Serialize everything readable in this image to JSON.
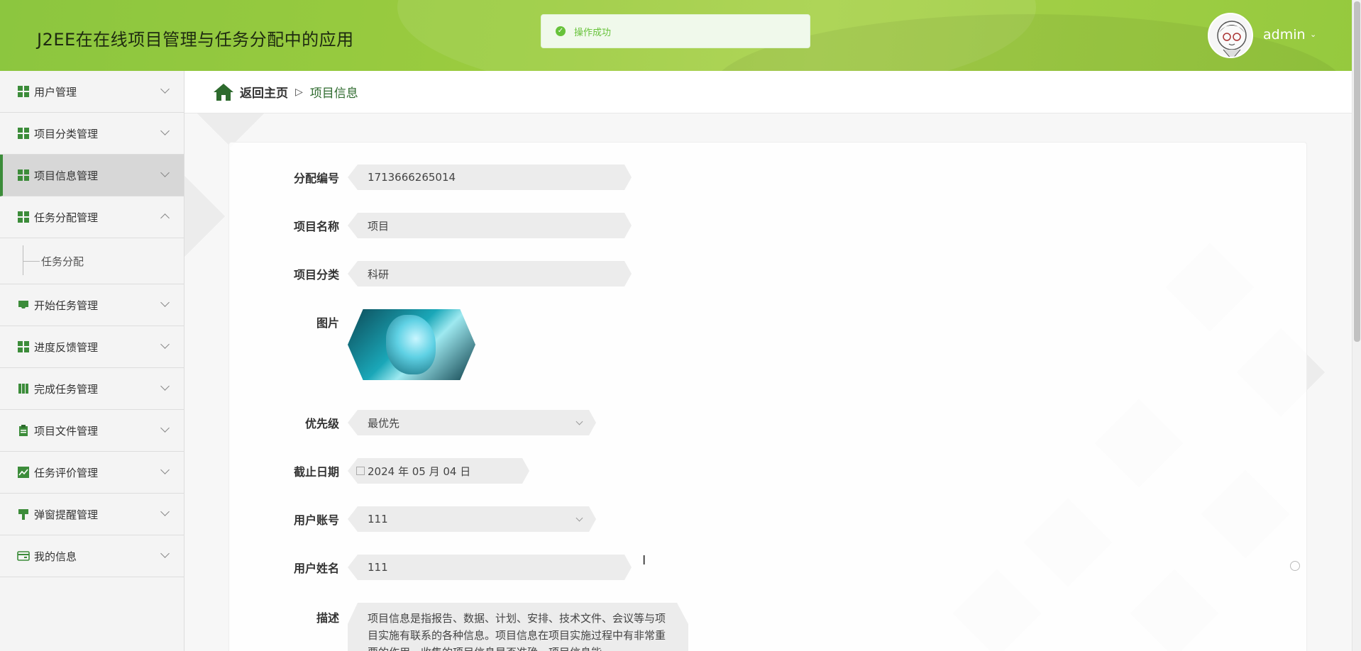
{
  "app": {
    "title": "J2EE在在线项目管理与任务分配中的应用"
  },
  "toast": {
    "message": "操作成功"
  },
  "user": {
    "name": "admin"
  },
  "sidebar": {
    "items": [
      {
        "label": "用户管理",
        "icon": "grid-icon"
      },
      {
        "label": "项目分类管理",
        "icon": "grid-icon"
      },
      {
        "label": "项目信息管理",
        "icon": "grid-icon",
        "active": true
      },
      {
        "label": "任务分配管理",
        "icon": "grid-icon",
        "expanded": true
      },
      {
        "label": "开始任务管理",
        "icon": "inbox-icon"
      },
      {
        "label": "进度反馈管理",
        "icon": "grid-icon"
      },
      {
        "label": "完成任务管理",
        "icon": "book-icon"
      },
      {
        "label": "项目文件管理",
        "icon": "clipboard-icon"
      },
      {
        "label": "任务评价管理",
        "icon": "chart-icon"
      },
      {
        "label": "弹窗提醒管理",
        "icon": "brush-icon"
      },
      {
        "label": "我的信息",
        "icon": "card-icon"
      }
    ],
    "submenu": {
      "label": "任务分配"
    }
  },
  "breadcrumb": {
    "home": "返回主页",
    "separator": "▷",
    "current": "项目信息"
  },
  "form": {
    "assign_no": {
      "label": "分配编号",
      "value": "1713666265014"
    },
    "project_name": {
      "label": "项目名称",
      "value": "项目"
    },
    "category": {
      "label": "项目分类",
      "value": "科研"
    },
    "image": {
      "label": "图片"
    },
    "priority": {
      "label": "优先级",
      "value": "最优先"
    },
    "deadline": {
      "label": "截止日期",
      "value": "2024 年 05 月 04 日"
    },
    "account": {
      "label": "用户账号",
      "value": "111"
    },
    "username": {
      "label": "用户姓名",
      "value": "111"
    },
    "description": {
      "label": "描述",
      "value": "项目信息是指报告、数据、计划、安排、技术文件、会议等与项目实施有联系的各种信息。项目信息在项目实施过程中有非常重要的作用，收集的项目信息是否准确、项目信息能"
    }
  },
  "colors": {
    "header": "#8cc63f",
    "accent": "#2d6a2d",
    "toast_text": "#67c23a"
  }
}
